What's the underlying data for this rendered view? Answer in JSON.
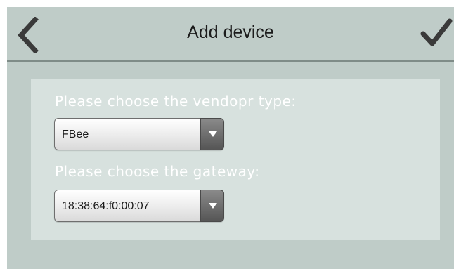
{
  "header": {
    "title": "Add device",
    "back_icon": "chevron-left-icon",
    "done_icon": "checkmark-icon"
  },
  "form": {
    "vendor": {
      "label": "Please choose the vendopr type:",
      "value": "FBee"
    },
    "gateway": {
      "label": "Please choose the gateway:",
      "value": "18:38:64:f0:00:07"
    }
  },
  "colors": {
    "background": "#bfccc8",
    "panel": "#d7e1de",
    "label_text": "#ffffff",
    "nav_icons": "#3a3a3a"
  }
}
